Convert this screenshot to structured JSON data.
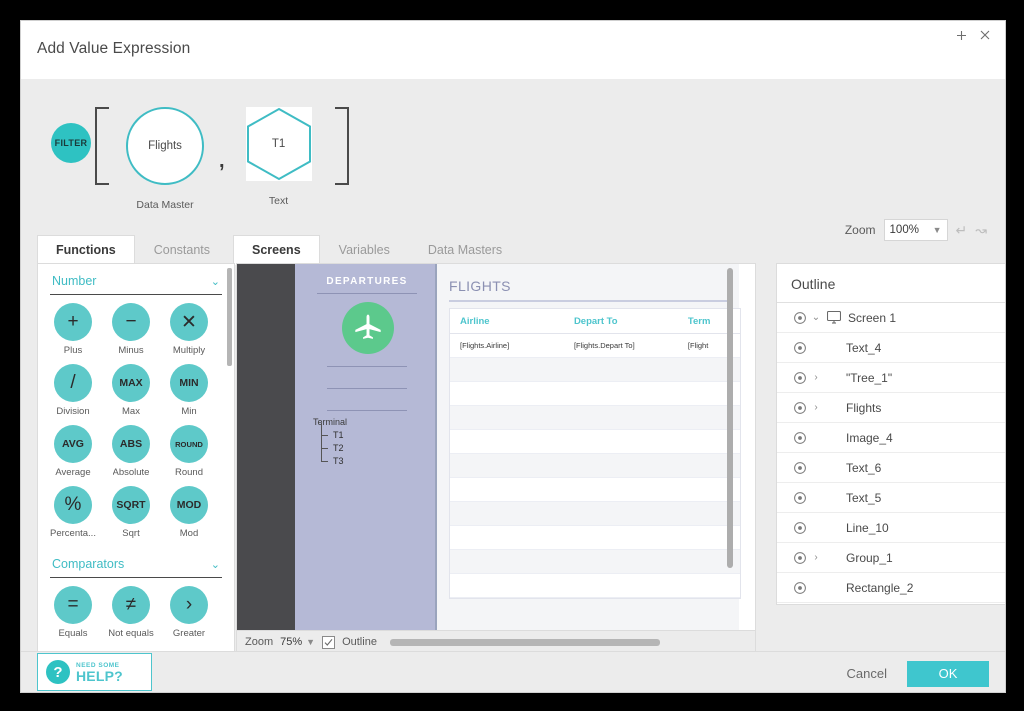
{
  "window": {
    "title": "Add Value Expression",
    "controls": [
      {
        "name": "add-icon",
        "glyph": "+"
      },
      {
        "name": "close-icon",
        "glyph": "×"
      }
    ]
  },
  "expression": {
    "function_chip": "FILTER",
    "open_bracket": "[",
    "close_bracket": "]",
    "separator": ",",
    "operands": [
      {
        "value": "Flights",
        "type_label": "Data Master",
        "shape": "circle"
      },
      {
        "value": "T1",
        "type_label": "Text",
        "shape": "hexagon"
      }
    ],
    "zoom": {
      "label": "Zoom",
      "value": "100%",
      "undo_icon": "undo-arrow",
      "redo_icon": "redo-arrow"
    }
  },
  "tabs_left": [
    {
      "label": "Functions",
      "active": true
    },
    {
      "label": "Constants",
      "active": false
    }
  ],
  "tabs_right": [
    {
      "label": "Screens",
      "active": true
    },
    {
      "label": "Variables",
      "active": false
    },
    {
      "label": "Data Masters",
      "active": false
    }
  ],
  "functions_panel": {
    "sections": [
      {
        "title": "Number",
        "items": [
          {
            "glyph": "+",
            "size": "big",
            "label": "Plus"
          },
          {
            "glyph": "−",
            "size": "big",
            "label": "Minus"
          },
          {
            "glyph": "✕",
            "size": "big",
            "label": "Multiply"
          },
          {
            "glyph": "/",
            "size": "big",
            "label": "Division"
          },
          {
            "glyph": "MAX",
            "size": "t10",
            "label": "Max"
          },
          {
            "glyph": "MIN",
            "size": "t10",
            "label": "Min"
          },
          {
            "glyph": "AVG",
            "size": "t10",
            "label": "Average"
          },
          {
            "glyph": "ABS",
            "size": "t10",
            "label": "Absolute"
          },
          {
            "glyph": "ROUND",
            "size": "t8",
            "label": "Round"
          },
          {
            "glyph": "%",
            "size": "big",
            "label": "Percenta..."
          },
          {
            "glyph": "SQRT",
            "size": "t10",
            "label": "Sqrt"
          },
          {
            "glyph": "MOD",
            "size": "t10",
            "label": "Mod"
          }
        ]
      },
      {
        "title": "Comparators",
        "items": [
          {
            "glyph": "=",
            "size": "big",
            "label": "Equals"
          },
          {
            "glyph": "≠",
            "size": "big",
            "label": "Not equals"
          },
          {
            "glyph": "›",
            "size": "big",
            "label": "Greater"
          }
        ]
      }
    ]
  },
  "preview": {
    "screen": {
      "departures_title": "DEPARTURES",
      "plane_icon": "airplane-icon",
      "terminal_label": "Terminal",
      "terminal_items": [
        "T1",
        "T2",
        "T3"
      ],
      "flights_title": "FLIGHTS",
      "table": {
        "headers": [
          "Airline",
          "Depart To",
          "Term"
        ],
        "rows": [
          [
            "[Flights.Airline]",
            "[Flights.Depart To]",
            "[Flight"
          ]
        ],
        "empty_row_count": 10
      }
    },
    "toolbar": {
      "zoom_label": "Zoom",
      "zoom_value": "75%",
      "outline_label": "Outline",
      "outline_checked": true
    }
  },
  "outline": {
    "title": "Outline",
    "rows": [
      {
        "label": "Screen 1",
        "chevron": "down",
        "icon": "monitor-icon"
      },
      {
        "label": "Text_4",
        "chevron": "none",
        "icon": ""
      },
      {
        "label": "\"Tree_1\"",
        "chevron": "right",
        "icon": ""
      },
      {
        "label": "Flights",
        "chevron": "right",
        "icon": ""
      },
      {
        "label": "Image_4",
        "chevron": "none",
        "icon": ""
      },
      {
        "label": "Text_6",
        "chevron": "none",
        "icon": ""
      },
      {
        "label": "Text_5",
        "chevron": "none",
        "icon": ""
      },
      {
        "label": "Line_10",
        "chevron": "none",
        "icon": ""
      },
      {
        "label": "Group_1",
        "chevron": "right",
        "icon": ""
      },
      {
        "label": "Rectangle_2",
        "chevron": "none",
        "icon": ""
      }
    ]
  },
  "footer": {
    "help": {
      "line1": "NEED SOME",
      "line2": "HELP?",
      "icon": "question-mark-icon"
    },
    "cancel_label": "Cancel",
    "ok_label": "OK"
  },
  "colors": {
    "accent_teal": "#3fc6ce",
    "chip_teal": "#2ec2c2",
    "fn_teal": "#5ec9c9",
    "plane_green": "#5cc98c",
    "preview_lavender": "#b5b9d6",
    "preview_dark": "#4a4a4d"
  }
}
